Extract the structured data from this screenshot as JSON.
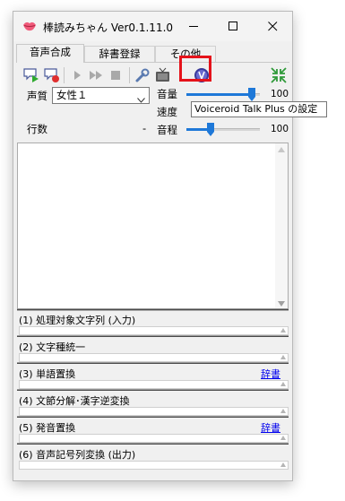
{
  "window": {
    "title": "棒読みちゃん Ver0.1.11.0 B..."
  },
  "tabs": [
    {
      "label": "音声合成"
    },
    {
      "label": "辞書登録"
    },
    {
      "label": "その他"
    }
  ],
  "controls": {
    "voice_label": "声質",
    "voice_value": "女性１",
    "line_count_label": "行数",
    "line_count_value": "-",
    "volume_label": "音量",
    "volume_value": "100",
    "speed_label": "速度",
    "pitch_label": "音程",
    "pitch_value": "100"
  },
  "tooltip": "Voiceroid Talk Plus の設定",
  "stages": [
    {
      "title": "(1) 処理対象文字列 (入力)",
      "link": ""
    },
    {
      "title": "(2) 文字種統一",
      "link": ""
    },
    {
      "title": "(3) 単語置換",
      "link": "辞書"
    },
    {
      "title": "(4) 文節分解･漢字逆変換",
      "link": ""
    },
    {
      "title": "(5) 発音置換",
      "link": "辞書"
    },
    {
      "title": "(6) 音声記号列変換 (出力)",
      "link": ""
    }
  ]
}
